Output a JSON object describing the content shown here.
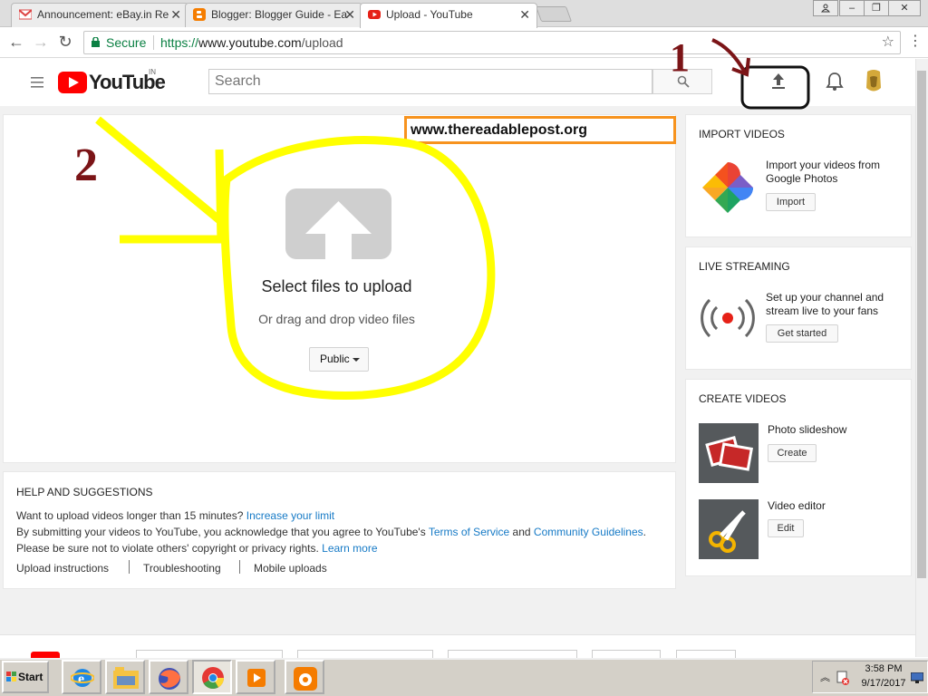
{
  "browser": {
    "tabs": [
      {
        "title": "Announcement: eBay.in Re",
        "favicon": "gmail-icon"
      },
      {
        "title": "Blogger: Blogger Guide - Ea",
        "favicon": "blogger-icon"
      },
      {
        "title": "Upload - YouTube",
        "favicon": "youtube-icon"
      }
    ],
    "secure_label": "Secure",
    "url_scheme": "https://",
    "url_host": "www.youtube.com",
    "url_path": "/upload"
  },
  "youtube": {
    "logo_text": "YouTube",
    "region": "IN",
    "search_placeholder": "Search",
    "accent": "#ff0000"
  },
  "upload": {
    "title": "Select files to upload",
    "subtitle": "Or drag and drop video files",
    "privacy": "Public"
  },
  "watermark": "www.thereadablepost.org",
  "annotations": {
    "one": "1",
    "two": "2"
  },
  "help": {
    "title": "HELP AND SUGGESTIONS",
    "line1_text": "Want to upload videos longer than 15 minutes?",
    "line1_link": "Increase your limit",
    "line2_text": "By submitting your videos to YouTube, you acknowledge that you agree to YouTube's",
    "line2_link1": "Terms of Service",
    "line2_and": "and",
    "line2_link2": "Community Guidelines",
    "line3_text": "Please be sure not to violate others' copyright or privacy rights.",
    "line3_link": "Learn more",
    "links": [
      "Upload instructions",
      "Troubleshooting",
      "Mobile uploads"
    ]
  },
  "side": {
    "import": {
      "title": "IMPORT VIDEOS",
      "text": "Import your videos from Google Photos",
      "button": "Import"
    },
    "live": {
      "title": "LIVE STREAMING",
      "text": "Set up your channel and stream live to your fans",
      "button": "Get started"
    },
    "create": {
      "title": "CREATE VIDEOS",
      "slideshow": {
        "label": "Photo slideshow",
        "button": "Create"
      },
      "editor": {
        "label": "Video editor",
        "button": "Edit"
      }
    }
  },
  "taskbar": {
    "start": "Start",
    "time": "3:58 PM",
    "date": "9/17/2017"
  }
}
